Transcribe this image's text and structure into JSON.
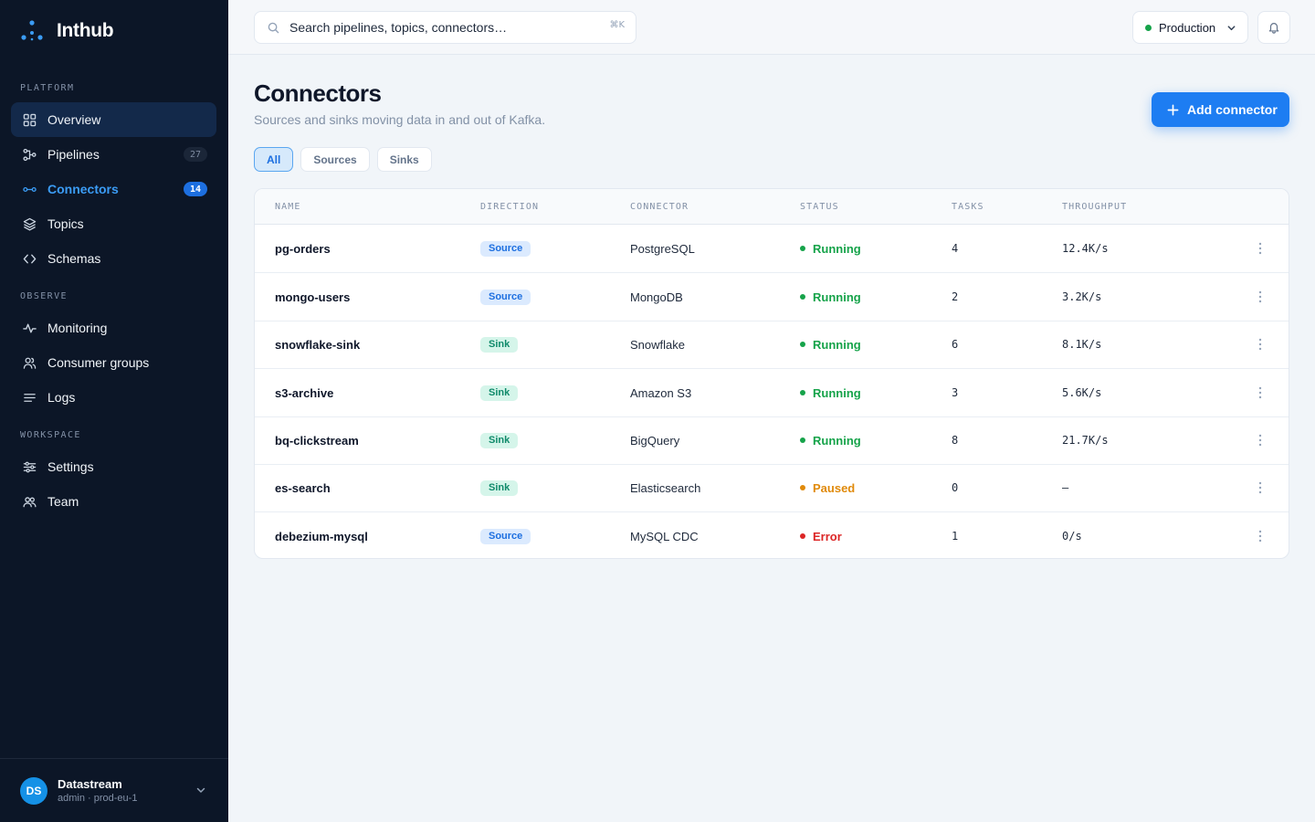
{
  "app": {
    "name": "Inthub"
  },
  "sidebar": {
    "sections": [
      {
        "label": "PLATFORM"
      },
      {
        "label": "OBSERVE"
      },
      {
        "label": "WORKSPACE"
      }
    ],
    "items": [
      {
        "label": "Overview",
        "icon": "grid-icon"
      },
      {
        "label": "Pipelines",
        "icon": "pipeline-icon",
        "badge": "27"
      },
      {
        "label": "Connectors",
        "icon": "connector-icon",
        "badge": "14"
      },
      {
        "label": "Topics",
        "icon": "layers-icon"
      },
      {
        "label": "Schemas",
        "icon": "code-icon"
      },
      {
        "label": "Monitoring",
        "icon": "pulse-icon"
      },
      {
        "label": "Consumer groups",
        "icon": "users-icon"
      },
      {
        "label": "Logs",
        "icon": "lines-icon"
      },
      {
        "label": "Settings",
        "icon": "sliders-icon"
      },
      {
        "label": "Team",
        "icon": "team-icon"
      }
    ],
    "account": {
      "initials": "DS",
      "name": "Datastream",
      "sub": "admin · prod-eu-1"
    }
  },
  "topbar": {
    "search_placeholder": "Search pipelines, topics, connectors…",
    "search_shortcut": "⌘K",
    "environment": "Production",
    "colors": {
      "environment_dot": "#16a34a"
    }
  },
  "page": {
    "title": "Connectors",
    "subtitle": "Sources and sinks moving data in and out of Kafka.",
    "add_button": "Add connector",
    "filters": [
      "All",
      "Sources",
      "Sinks"
    ],
    "active_filter": "All"
  },
  "table": {
    "columns": [
      "NAME",
      "DIRECTION",
      "CONNECTOR",
      "STATUS",
      "TASKS",
      "THROUGHPUT"
    ],
    "rows": [
      {
        "name": "pg-orders",
        "direction": "Source",
        "connector": "PostgreSQL",
        "status": "Running",
        "tasks": "4",
        "throughput": "12.4K/s"
      },
      {
        "name": "mongo-users",
        "direction": "Source",
        "connector": "MongoDB",
        "status": "Running",
        "tasks": "2",
        "throughput": "3.2K/s"
      },
      {
        "name": "snowflake-sink",
        "direction": "Sink",
        "connector": "Snowflake",
        "status": "Running",
        "tasks": "6",
        "throughput": "8.1K/s"
      },
      {
        "name": "s3-archive",
        "direction": "Sink",
        "connector": "Amazon S3",
        "status": "Running",
        "tasks": "3",
        "throughput": "5.6K/s"
      },
      {
        "name": "bq-clickstream",
        "direction": "Sink",
        "connector": "BigQuery",
        "status": "Running",
        "tasks": "8",
        "throughput": "21.7K/s"
      },
      {
        "name": "es-search",
        "direction": "Sink",
        "connector": "Elasticsearch",
        "status": "Paused",
        "tasks": "0",
        "throughput": "—"
      },
      {
        "name": "debezium-mysql",
        "direction": "Source",
        "connector": "MySQL CDC",
        "status": "Error",
        "tasks": "1",
        "throughput": "0/s"
      }
    ],
    "status_colors": {
      "Running": "#16a34a",
      "Paused": "#e08a0b",
      "Error": "#dc2626"
    }
  }
}
